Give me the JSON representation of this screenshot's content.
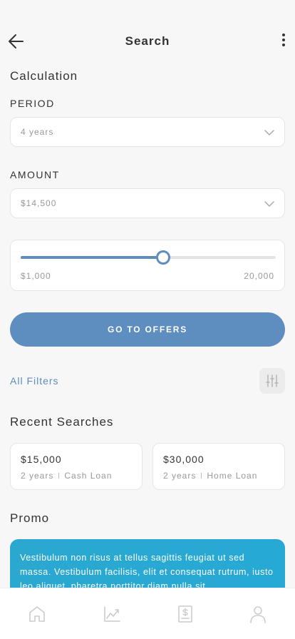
{
  "header": {
    "title": "Search",
    "back_icon": "arrow-left-icon",
    "more_icon": "more-vertical-icon"
  },
  "calculation": {
    "title": "Calculation",
    "period": {
      "label": "PERIOD",
      "value": "4 years"
    },
    "amount": {
      "label": "AMOUNT",
      "value": "$14,500"
    },
    "slider": {
      "min_label": "$1,000",
      "max_label": "20,000",
      "min": 1000,
      "max": 20000,
      "value": 11600
    },
    "cta_label": "GO TO OFFERS"
  },
  "filters": {
    "label": "All Filters",
    "icon": "sliders-icon"
  },
  "recent": {
    "title": "Recent Searches",
    "items": [
      {
        "amount": "$15,000",
        "period": "2 years",
        "type": "Cash Loan"
      },
      {
        "amount": "$30,000",
        "period": "2 years",
        "type": "Home Loan"
      }
    ]
  },
  "promo": {
    "title": "Promo",
    "text": "Vestibulum non risus at tellus sagittis feugiat ut sed massa. Vestibulum facilisis, elit et consequat rutrum, iusto leo aliquet, pharetra porttitor diam nulla sit"
  },
  "tabbar": {
    "items": [
      "home-icon",
      "chart-icon",
      "receipt-icon",
      "profile-icon"
    ]
  },
  "colors": {
    "accent": "#5e8dbf",
    "promo": "#2aa8d0",
    "background": "#f7f7f7"
  }
}
